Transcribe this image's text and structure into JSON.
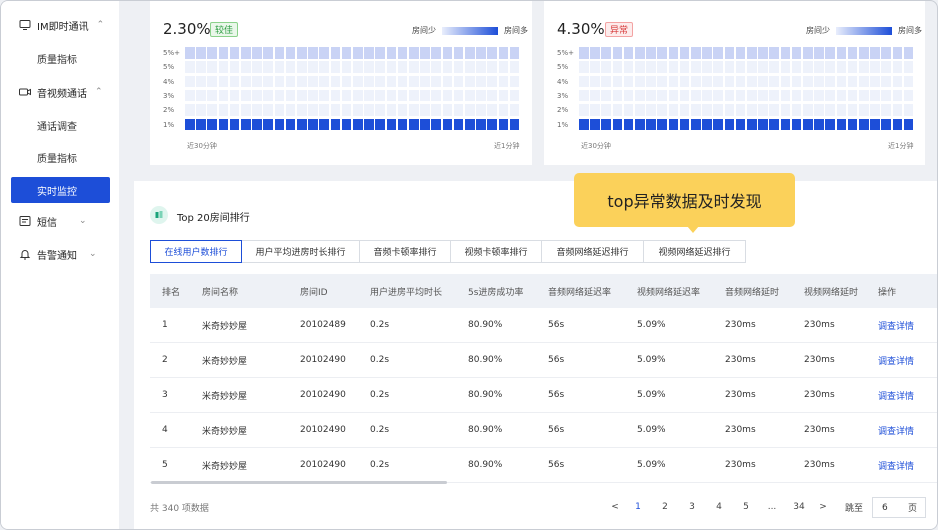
{
  "sidebar": {
    "groups": [
      {
        "label": "IM即时通讯",
        "icon": "monitor-icon",
        "chevron": "^"
      },
      {
        "label": "音视频通话",
        "icon": "video-icon",
        "chevron": "^"
      },
      {
        "label": "短信",
        "icon": "sms-icon",
        "chevron": "v"
      },
      {
        "label": "告警通知",
        "icon": "bell-icon",
        "chevron": "v"
      }
    ],
    "sub_items": [
      "质量指标",
      "通话调查",
      "质量指标"
    ],
    "active_item": "实时监控"
  },
  "cards": [
    {
      "rate": "2.30%",
      "badge": "较佳",
      "badge_type": "ok",
      "legend_low": "房间少",
      "legend_high": "房间多",
      "y_ticks": [
        "5%+",
        "5%",
        "4%",
        "3%",
        "2%",
        "1%"
      ],
      "x_start": "近30分钟",
      "x_end": "近1分钟"
    },
    {
      "rate": "4.30%",
      "badge": "异常",
      "badge_type": "bad",
      "legend_low": "房间少",
      "legend_high": "房间多",
      "y_ticks": [
        "5%+",
        "5%",
        "4%",
        "3%",
        "2%",
        "1%"
      ],
      "x_start": "近30分钟",
      "x_end": "近1分钟"
    }
  ],
  "colors": {
    "accent": "#1d4ed8",
    "heat_low": "#eef2fb",
    "heat_mid": "#c9d3f5",
    "heat_high": "#1d4ed8",
    "tooltip": "#fbd15a"
  },
  "ranking": {
    "title": "Top 20房间排行",
    "tooltip": "top异常数据及时发现",
    "tabs": [
      "在线用户数排行",
      "用户平均进房时长排行",
      "音频卡顿率排行",
      "视频卡顿率排行",
      "音频网络延迟排行",
      "视频网络延迟排行"
    ],
    "active_tab": 0,
    "columns": [
      "排名",
      "房间名称",
      "房间ID",
      "用户进房平均时长",
      "5s进房成功率",
      "音频网络延迟率",
      "视频网络延迟率",
      "音频网络延时",
      "视频网络延时",
      "操作"
    ],
    "rows": [
      [
        "1",
        "米奇妙妙屋",
        "20102489",
        "0.2s",
        "80.90%",
        "56s",
        "5.09%",
        "230ms",
        "230ms",
        "调查详情"
      ],
      [
        "2",
        "米奇妙妙屋",
        "20102490",
        "0.2s",
        "80.90%",
        "56s",
        "5.09%",
        "230ms",
        "230ms",
        "调查详情"
      ],
      [
        "3",
        "米奇妙妙屋",
        "20102490",
        "0.2s",
        "80.90%",
        "56s",
        "5.09%",
        "230ms",
        "230ms",
        "调查详情"
      ],
      [
        "4",
        "米奇妙妙屋",
        "20102490",
        "0.2s",
        "80.90%",
        "56s",
        "5.09%",
        "230ms",
        "230ms",
        "调查详情"
      ],
      [
        "5",
        "米奇妙妙屋",
        "20102490",
        "0.2s",
        "80.90%",
        "56s",
        "5.09%",
        "230ms",
        "230ms",
        "调查详情"
      ]
    ]
  },
  "pagination": {
    "total": "共 340 项数据",
    "prev": "<",
    "next": ">",
    "pages": [
      "1",
      "2",
      "3",
      "4",
      "5",
      "...",
      "34"
    ],
    "active_page": "1",
    "jump_label": "跳至",
    "jump_value": "6",
    "page_unit": "页"
  }
}
